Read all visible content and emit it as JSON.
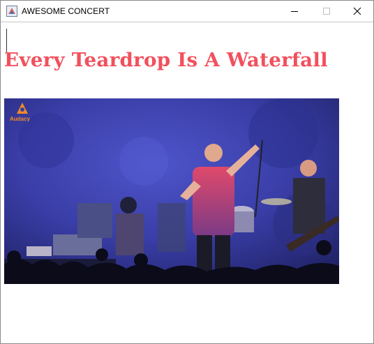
{
  "window": {
    "title": "AWESOME CONCERT",
    "icon": "java-app-icon",
    "controls": [
      "minimize-icon",
      "maximize-icon",
      "close-icon"
    ]
  },
  "main": {
    "song_title": "Every Teardrop Is A Waterfall",
    "song_title_color": "#f2505d",
    "video": {
      "description_icon": "concert-video-frame",
      "watermark": "Audacy",
      "watermark_color": "#f08a24"
    }
  }
}
